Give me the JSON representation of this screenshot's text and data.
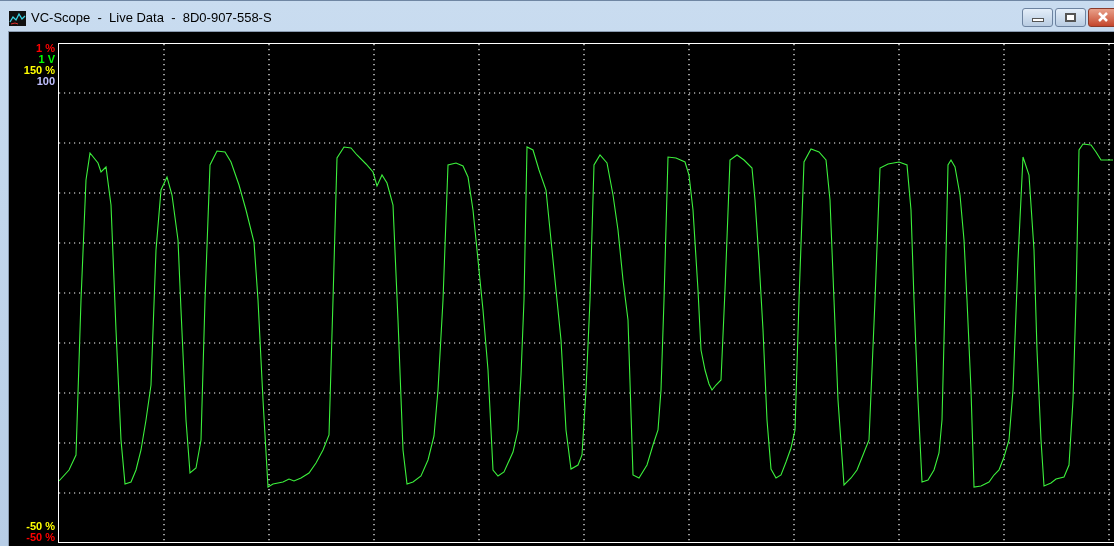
{
  "window": {
    "title": "VC-Scope  -  Live Data  -  8D0-907-558-S"
  },
  "scale_labels_top": [
    {
      "text": "1 %",
      "color": "#ff0000"
    },
    {
      "text": "1 V",
      "color": "#00ff00"
    },
    {
      "text": "150 %",
      "color": "#ffff00"
    },
    {
      "text": "100",
      "color": "#c0c0ff"
    }
  ],
  "scale_labels_bottom": [
    {
      "text": "-50 %",
      "color": "#ffff00"
    },
    {
      "text": "-50 %",
      "color": "#ff0000"
    }
  ]
}
